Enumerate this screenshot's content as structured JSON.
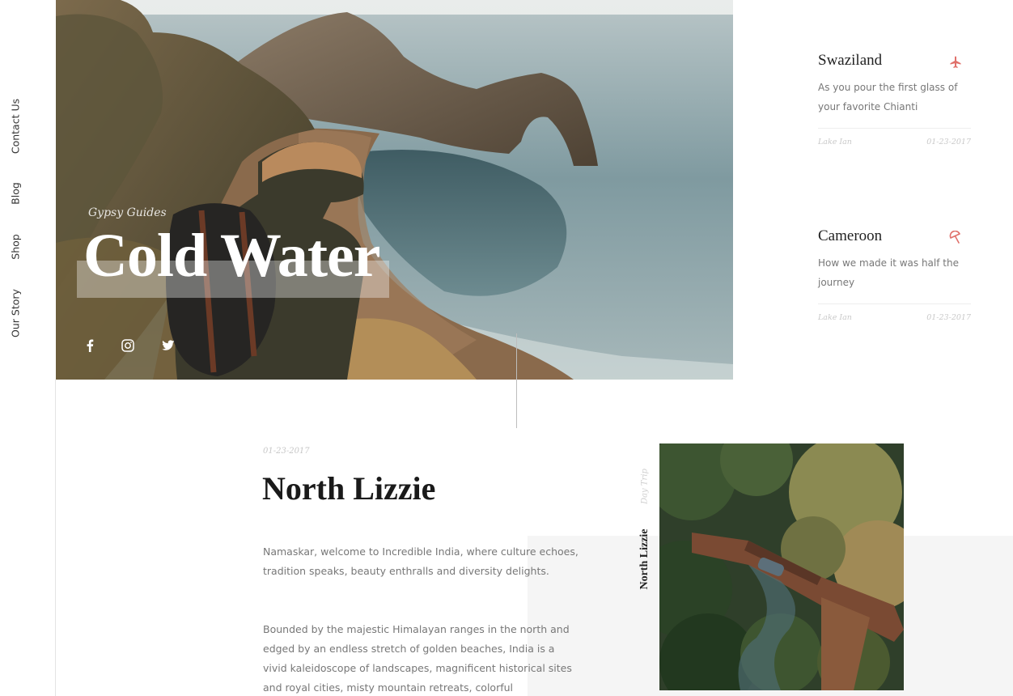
{
  "nav": {
    "items": [
      "Contact Us",
      "Blog",
      "Shop",
      "Our Story"
    ]
  },
  "hero": {
    "subtitle": "Gypsy Guides",
    "title": "Cold Water",
    "social": [
      "facebook-icon",
      "instagram-icon",
      "twitter-icon"
    ]
  },
  "posts": [
    {
      "title": "Swaziland",
      "text": "As you pour the first glass of your favorite Chianti",
      "author": "Lake Ian",
      "date": "01-23-2017",
      "icon": "airplane-icon",
      "icon_color": "#e0706a"
    },
    {
      "title": "Cameroon",
      "text": "How we made it was half the journey",
      "author": "Lake Ian",
      "date": "01-23-2017",
      "icon": "umbrella-icon",
      "icon_color": "#e0706a"
    }
  ],
  "article": {
    "date": "01-23-2017",
    "title": "North Lizzie",
    "paragraphs": [
      "Namaskar, welcome to Incredible India, where culture echoes, tradition speaks, beauty enthralls and diversity delights.",
      "Bounded by the majestic Himalayan ranges in the north and edged by an endless stretch of golden beaches, India is a vivid kaleidoscope of landscapes, magnificent historical sites and royal cities, misty mountain retreats, colorful"
    ],
    "category": "Day Trip",
    "feature_label": "North Lizzie"
  }
}
